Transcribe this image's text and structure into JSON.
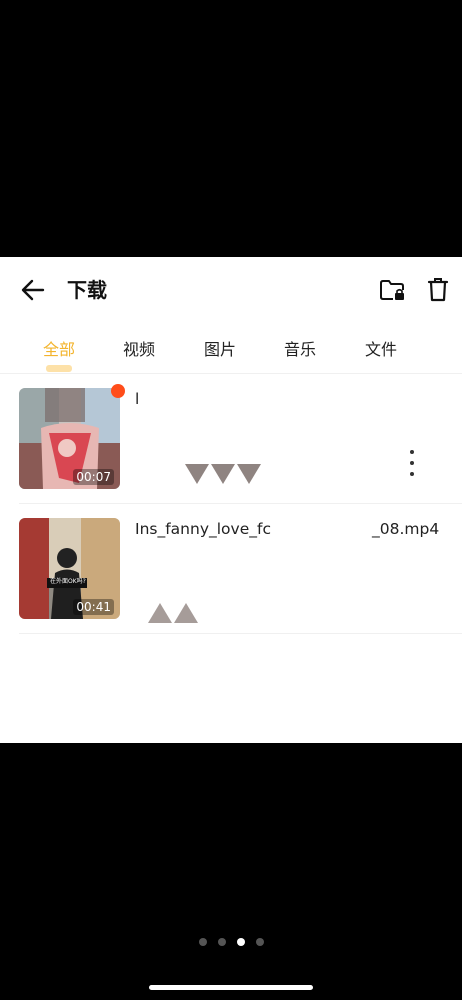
{
  "header": {
    "title": "下载",
    "back_icon": "arrow-left-icon",
    "folder_icon": "folder-lock-icon",
    "trash_icon": "trash-icon"
  },
  "tabs": [
    {
      "label": "全部",
      "active": true
    },
    {
      "label": "视频",
      "active": false
    },
    {
      "label": "图片",
      "active": false
    },
    {
      "label": "音乐",
      "active": false
    },
    {
      "label": "文件",
      "active": false
    }
  ],
  "files": [
    {
      "name": "l",
      "duration": "00:07",
      "is_new": true
    },
    {
      "name": "Ins_fanny_love_fc",
      "name_suffix": "_08.mp4",
      "duration": "00:41",
      "is_new": false
    }
  ],
  "thumb2_caption": "在外面OK吗?",
  "colors": {
    "accent": "#f3b42d",
    "new_dot": "#ff4d1a",
    "background": "#000000",
    "card": "#ffffff"
  },
  "pager": {
    "count": 4,
    "active_index": 2
  }
}
